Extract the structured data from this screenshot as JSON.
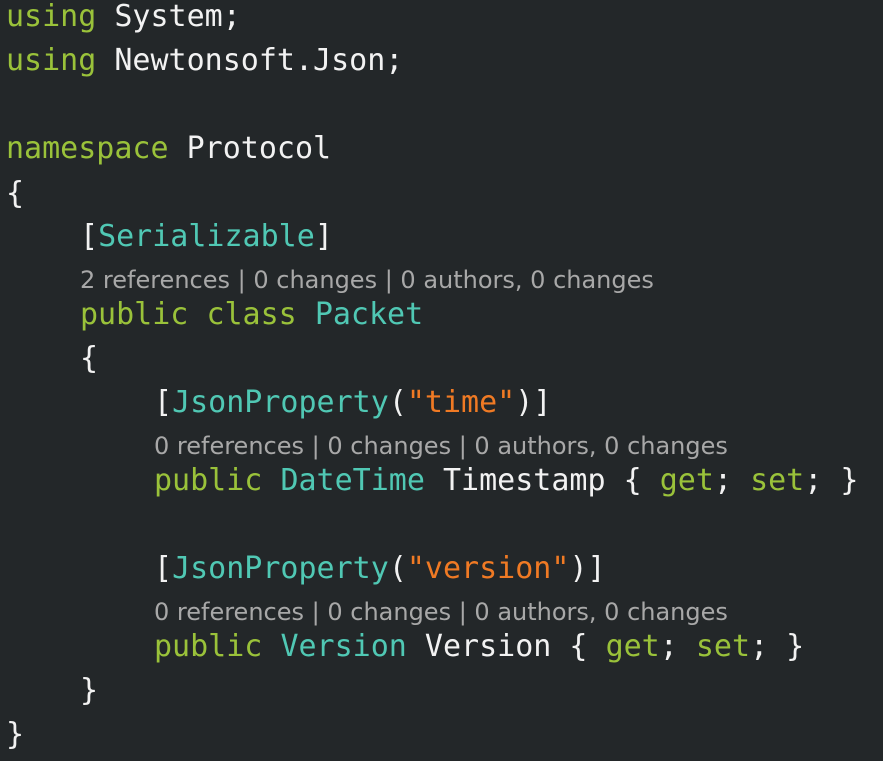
{
  "code": {
    "l1": {
      "kw": "using",
      "rest": " System;"
    },
    "l2": {
      "kw": "using",
      "rest": " Newtonsoft.Json;"
    },
    "l4": {
      "kw": "namespace",
      "rest": " Protocol"
    },
    "l5": {
      "brace": "{"
    },
    "l6": {
      "open": "[",
      "attr": "Serializable",
      "close": "]"
    },
    "l7_lens": {
      "refs": "2 references",
      "sep1": " | ",
      "changes": "0 changes",
      "sep2": " | ",
      "authors": "0 authors, 0 changes"
    },
    "l8": {
      "kw1": "public",
      "kw2": "class",
      "type": "Packet"
    },
    "l9": {
      "brace": "{"
    },
    "l10": {
      "open": "[",
      "attr": "JsonProperty",
      "paren_open": "(",
      "str": "\"time\"",
      "paren_close": ")",
      "close": "]"
    },
    "l11_lens": {
      "refs": "0 references",
      "sep1": " | ",
      "changes": "0 changes",
      "sep2": " | ",
      "authors": "0 authors, 0 changes"
    },
    "l12": {
      "kw": "public",
      "type": "DateTime",
      "name": " Timestamp { ",
      "get": "get",
      "semi1": "; ",
      "set": "set",
      "end": "; }"
    },
    "l14": {
      "open": "[",
      "attr": "JsonProperty",
      "paren_open": "(",
      "str": "\"version\"",
      "paren_close": ")",
      "close": "]"
    },
    "l15_lens": {
      "refs": "0 references",
      "sep1": " | ",
      "changes": "0 changes",
      "sep2": " | ",
      "authors": "0 authors, 0 changes"
    },
    "l16": {
      "kw": "public",
      "type": "Version",
      "name": " Version { ",
      "get": "get",
      "semi1": "; ",
      "set": "set",
      "end": "; }"
    },
    "l17": {
      "brace": "}"
    },
    "l18": {
      "brace": "}"
    }
  }
}
